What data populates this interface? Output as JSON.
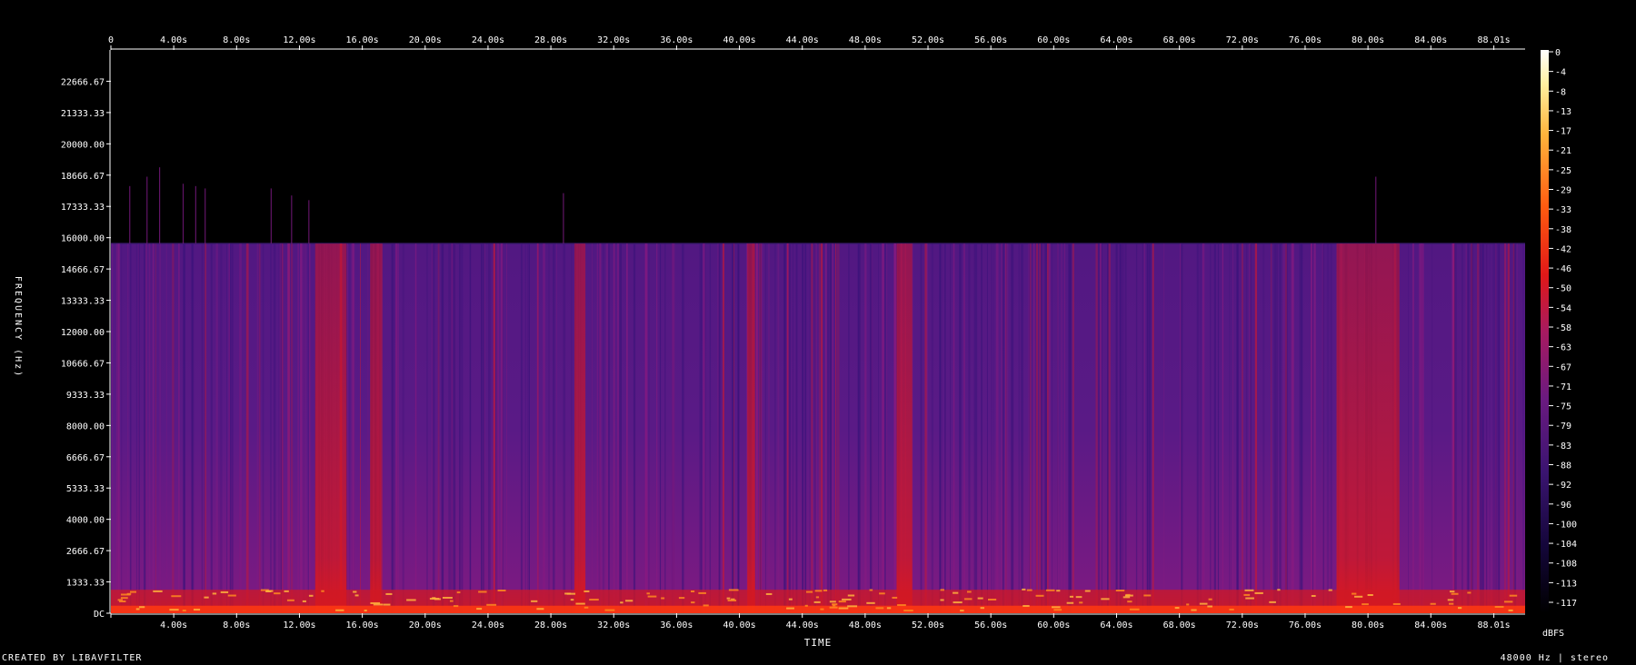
{
  "chart_data": {
    "type": "heatmap",
    "title": "",
    "xlabel": "TIME",
    "ylabel": "FREQUENCY (Hz)",
    "colorbar_label": "dBFS",
    "xlim": [
      0,
      90.0
    ],
    "ylim": [
      0,
      24000
    ],
    "x_ticks": [
      "0",
      "4.00s",
      "8.00s",
      "12.00s",
      "16.00s",
      "20.00s",
      "24.00s",
      "28.00s",
      "32.00s",
      "36.00s",
      "40.00s",
      "44.00s",
      "48.00s",
      "52.00s",
      "56.00s",
      "60.00s",
      "64.00s",
      "68.00s",
      "72.00s",
      "76.00s",
      "80.00s",
      "84.00s",
      "88.01s"
    ],
    "x_ticks_bottom": [
      "",
      "4.00s",
      "8.00s",
      "12.00s",
      "16.00s",
      "20.00s",
      "24.00s",
      "28.00s",
      "32.00s",
      "36.00s",
      "40.00s",
      "44.00s",
      "48.00s",
      "52.00s",
      "56.00s",
      "60.00s",
      "64.00s",
      "68.00s",
      "72.00s",
      "76.00s",
      "80.00s",
      "84.00s",
      "88.01s"
    ],
    "y_ticks": [
      "DC",
      "1333.33",
      "2666.67",
      "4000.00",
      "5333.33",
      "6666.67",
      "8000.00",
      "9333.33",
      "10666.67",
      "12000.00",
      "13333.33",
      "14666.67",
      "16000.00",
      "17333.33",
      "18666.67",
      "20000.00",
      "21333.33",
      "22666.67"
    ],
    "colorbar_ticks": [
      "0",
      "-4",
      "-8",
      "-13",
      "-17",
      "-21",
      "-25",
      "-29",
      "-33",
      "-38",
      "-42",
      "-46",
      "-50",
      "-54",
      "-58",
      "-63",
      "-67",
      "-71",
      "-75",
      "-79",
      "-83",
      "-88",
      "-92",
      "-96",
      "-100",
      "-104",
      "-108",
      "-113",
      "-117"
    ],
    "bandwidth_cutoff_hz": 15750,
    "loud_regions_s": [
      [
        13,
        15
      ],
      [
        16.5,
        17.2
      ],
      [
        29.5,
        30.2
      ],
      [
        40.5,
        41
      ],
      [
        50,
        51
      ],
      [
        78,
        82
      ]
    ],
    "colors": [
      "#000000",
      "#1a0640",
      "#3c1470",
      "#5a1a80",
      "#8a1a78",
      "#c8142e",
      "#e01818",
      "#ff5a10",
      "#ffb43c",
      "#ffffc8",
      "#ffffff"
    ]
  },
  "footer": {
    "left": "CREATED BY LIBAVFILTER",
    "right": "48000 Hz | stereo"
  }
}
